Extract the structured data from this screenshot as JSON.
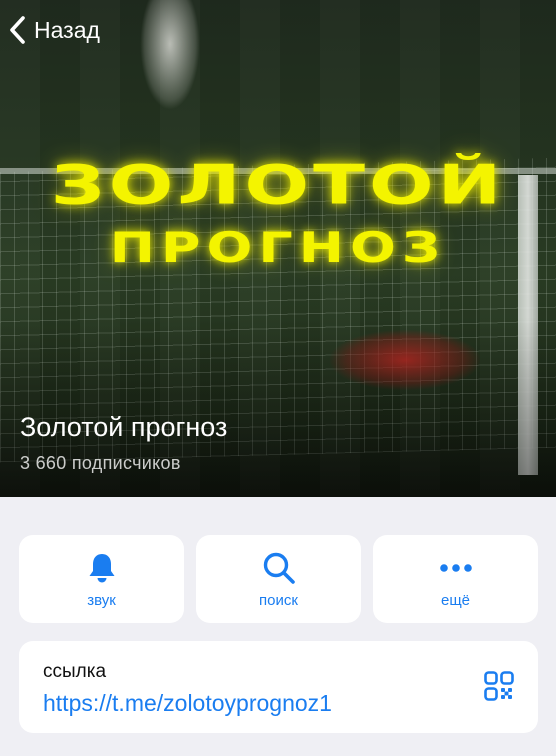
{
  "header": {
    "back_label": "Назад",
    "logo_line1": "ЗОЛОТОЙ",
    "logo_line2": "ПРОГНОЗ",
    "logo_color": "#f4f400"
  },
  "channel": {
    "title": "Золотой прогноз",
    "subscribers": "3 660 подписчиков"
  },
  "actions": [
    {
      "icon": "bell-icon",
      "label": "звук"
    },
    {
      "icon": "search-icon",
      "label": "поиск"
    },
    {
      "icon": "more-icon",
      "label": "ещё"
    }
  ],
  "link": {
    "caption": "ссылка",
    "url": "https://t.me/zolotoyprognoz1",
    "icon": "qr-code-icon"
  },
  "colors": {
    "accent": "#1a7df0",
    "background": "#efeff4",
    "card": "#ffffff"
  }
}
